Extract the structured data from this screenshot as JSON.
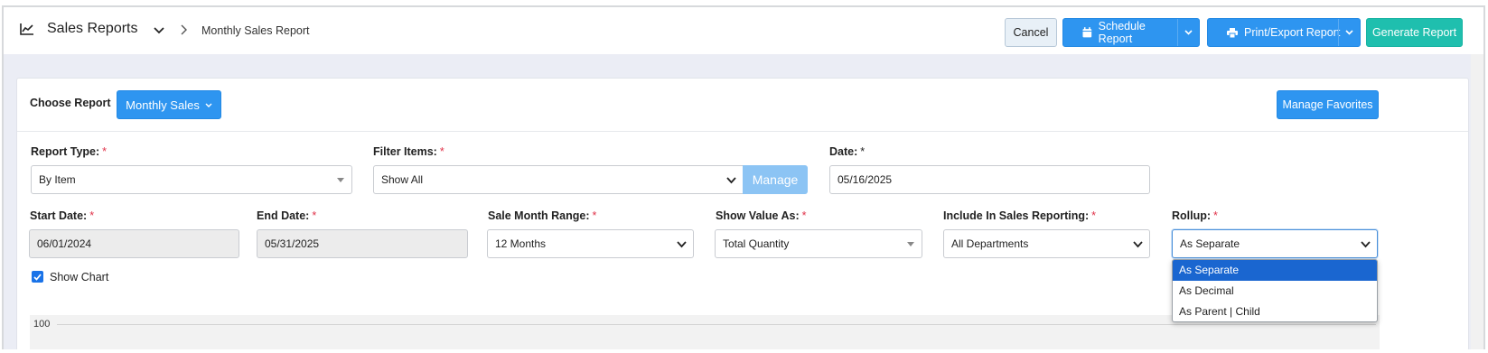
{
  "header": {
    "app_title": "Sales Reports",
    "app_icon": "line-chart-icon",
    "breadcrumb_current": "Monthly Sales Report",
    "cancel_label": "Cancel",
    "schedule_label": "Schedule Report",
    "print_label": "Print/Export Report",
    "generate_label": "Generate Report"
  },
  "choose": {
    "label": "Choose Report",
    "selected": "Monthly Sales",
    "favorites_label": "Manage Favorites"
  },
  "fields": {
    "report_type": {
      "label": "Report Type:",
      "value": "By Item"
    },
    "filter_items": {
      "label": "Filter Items:",
      "value": "Show All",
      "manage_label": "Manage"
    },
    "date": {
      "label": "Date:",
      "value": "05/16/2025"
    },
    "start_date": {
      "label": "Start Date:",
      "value": "06/01/2024"
    },
    "end_date": {
      "label": "End Date:",
      "value": "05/31/2025"
    },
    "sale_month_range": {
      "label": "Sale Month Range:",
      "value": "12 Months"
    },
    "show_value_as": {
      "label": "Show Value As:",
      "value": "Total Quantity"
    },
    "include_in_sales": {
      "label": "Include In Sales Reporting:",
      "value": "All Departments"
    },
    "rollup": {
      "label": "Rollup:",
      "value": "As Separate",
      "options": [
        "As Separate",
        "As Decimal",
        "As Parent | Child"
      ]
    }
  },
  "required_marker": "*",
  "show_chart": {
    "label": "Show Chart",
    "checked": true
  },
  "chart": {
    "first_tick": "100"
  },
  "colors": {
    "primary": "#2e95f0",
    "teal": "#1fbfae",
    "required": "#e0334a",
    "selected_option": "#1a66d0"
  }
}
